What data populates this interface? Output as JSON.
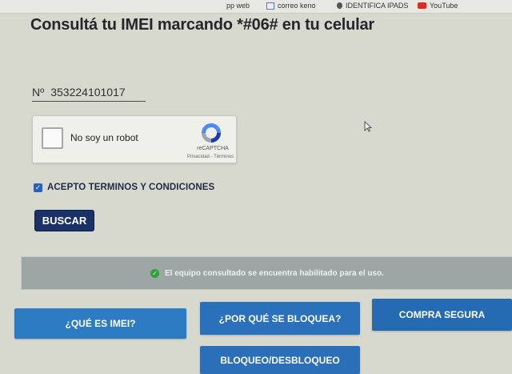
{
  "bookmarks": {
    "cut_item": "pp web",
    "correo": "correo keno",
    "apple": "IDENTIFICA IPADS",
    "youtube": "YouTube"
  },
  "title": "Consultá tu IMEI marcando *#06# en tu celular",
  "imei": {
    "prefix": "Nº",
    "value": "353224101017"
  },
  "recaptcha": {
    "label": "No soy un robot",
    "brand": "reCAPTCHA",
    "links": "Privacidad - Términos"
  },
  "terms": {
    "label": "ACEPTO TERMINOS Y CONDICIONES",
    "checked": true
  },
  "search_button": "BUSCAR",
  "result": {
    "message": "El equipo consultado se encuentra habilitado para el uso.",
    "status_color": "#2fa03a"
  },
  "nav": {
    "imei": "¿QUÉ ES IMEI?",
    "bloquea": "¿POR QUÉ SE BLOQUEA?",
    "compra": "COMPRA SEGURA",
    "bloqueo": "BLOQUEO/DESBLOQUEO"
  },
  "colors": {
    "accent": "#2a73bd",
    "dark_button": "#1b3268"
  }
}
